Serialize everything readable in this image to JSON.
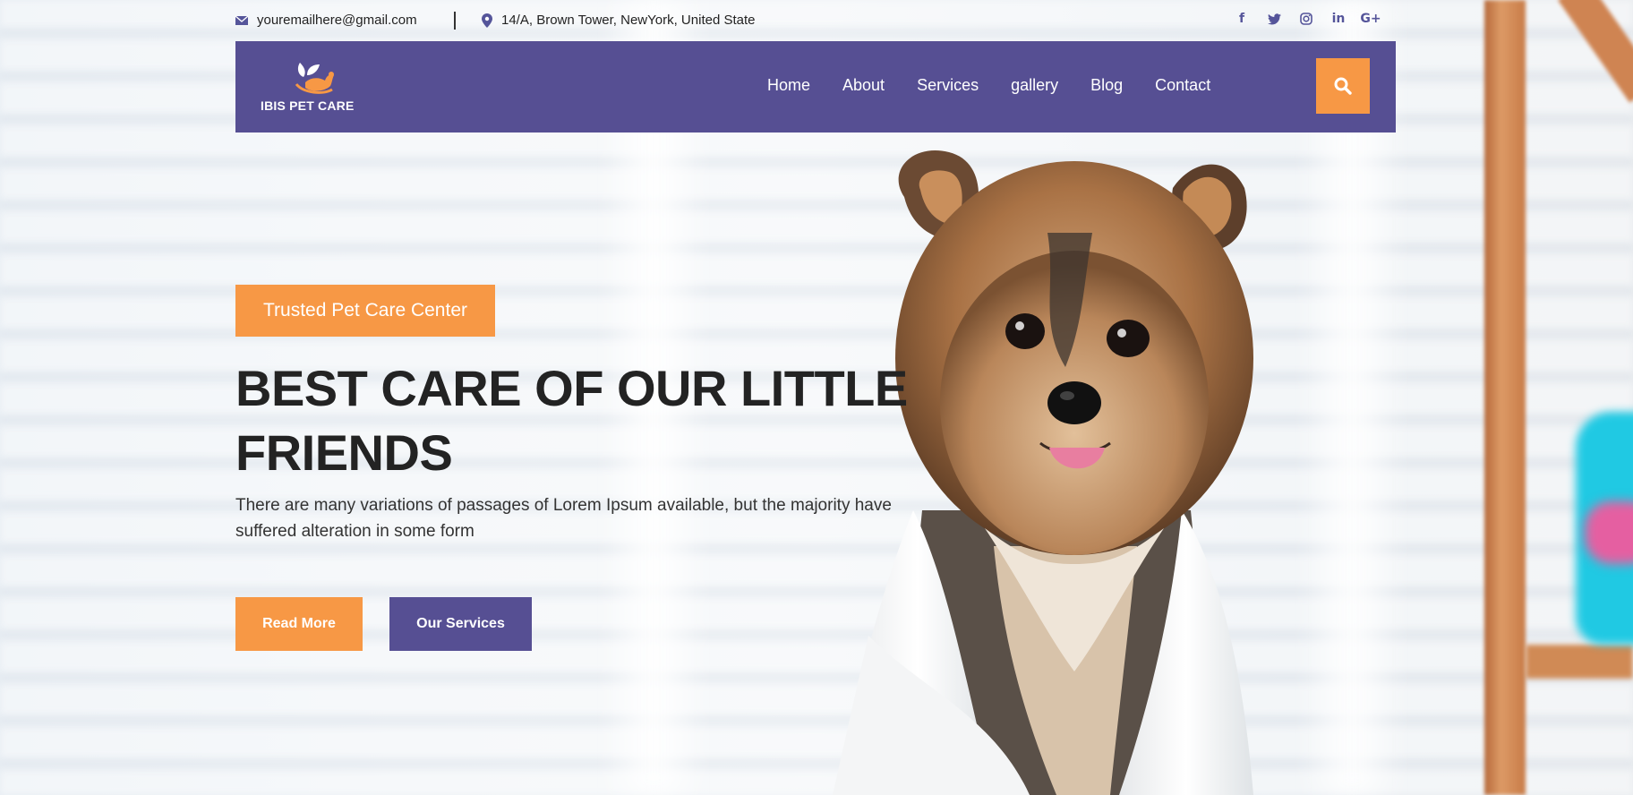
{
  "topbar": {
    "email": "youremailhere@gmail.com",
    "address": "14/A, Brown Tower, NewYork, United State",
    "social": [
      "f",
      "t",
      "o",
      "in",
      "G+"
    ]
  },
  "nav": {
    "brand": "IBIS PET CARE",
    "items": [
      "Home",
      "About",
      "Services",
      "gallery",
      "Blog",
      "Contact"
    ]
  },
  "hero": {
    "badge": "Trusted Pet Care Center",
    "headline": "BEST CARE OF OUR LITTLE FRIENDS",
    "subtitle": "There are many variations of passages of Lorem Ipsum available, but the majority have suffered alteration in some form",
    "primary_button": "Read More",
    "secondary_button": "Our Services"
  },
  "colors": {
    "brand_purple": "#564f93",
    "accent_orange": "#f79845"
  }
}
